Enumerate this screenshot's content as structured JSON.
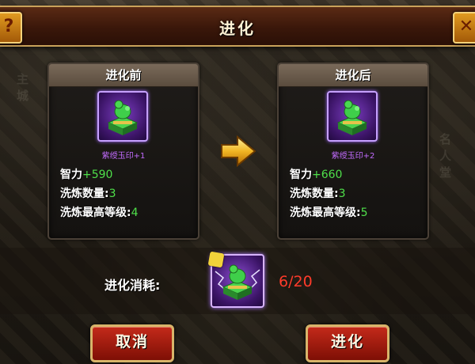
{
  "dialog": {
    "title": "进化"
  },
  "before": {
    "header": "进化前",
    "item_name": "紫绶玉印+1",
    "icon": "jade-seal-icon",
    "stats": [
      {
        "label": "智力",
        "value": "+590"
      },
      {
        "label": "洗炼数量:",
        "value": "3"
      },
      {
        "label": "洗炼最高等级:",
        "value": "4"
      }
    ]
  },
  "after": {
    "header": "进化后",
    "item_name": "紫绶玉印+2",
    "icon": "jade-seal-icon",
    "stats": [
      {
        "label": "智力",
        "value": "+660"
      },
      {
        "label": "洗炼数量:",
        "value": "3"
      },
      {
        "label": "洗炼最高等级:",
        "value": "5"
      }
    ]
  },
  "cost": {
    "label": "进化消耗:",
    "count": "6/20",
    "icon": "seal-fragment-icon"
  },
  "buttons": {
    "cancel": "取消",
    "evolve": "进化"
  },
  "background": {
    "left_text": "主城",
    "right_text": "名人堂"
  },
  "colors": {
    "stat_value": "#4fe04a",
    "cost_count": "#ff3b2a",
    "item_name": "#c36cff",
    "button": "#a31a0d"
  }
}
